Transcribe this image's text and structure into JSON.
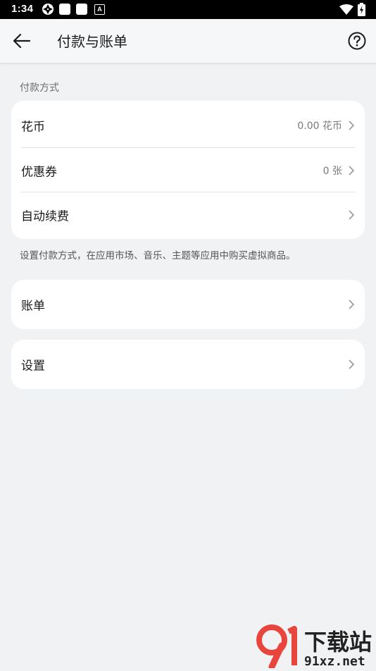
{
  "status_bar": {
    "time": "1:34",
    "left_icons": [
      "camera-aperture-icon",
      "notification-square-icon",
      "notification-square-icon",
      "text-a-icon"
    ],
    "a_glyph": "A",
    "right_icons": [
      "wifi-icon",
      "battery-charging-icon"
    ]
  },
  "header": {
    "title": "付款与账单",
    "back_icon": "arrow-left-icon",
    "help_icon": "question-circle-icon"
  },
  "payment_methods": {
    "section_label": "付款方式",
    "items": [
      {
        "label": "花币",
        "value": "0.00 花币"
      },
      {
        "label": "优惠券",
        "value": "0 张"
      },
      {
        "label": "自动续费",
        "value": ""
      }
    ],
    "note": "设置付款方式，在应用市场、音乐、主题等应用中购买虚拟商品。"
  },
  "bills": {
    "label": "账单"
  },
  "settings": {
    "label": "设置"
  },
  "watermark": {
    "text_top": "下载站",
    "text_bottom": "91xz.net",
    "colors": {
      "red": "#e8453c",
      "dark": "#222222"
    }
  },
  "colors": {
    "background": "#f1f2f4",
    "card": "#ffffff",
    "text_primary": "#1a1a1a",
    "text_secondary": "#7a7a7a"
  }
}
